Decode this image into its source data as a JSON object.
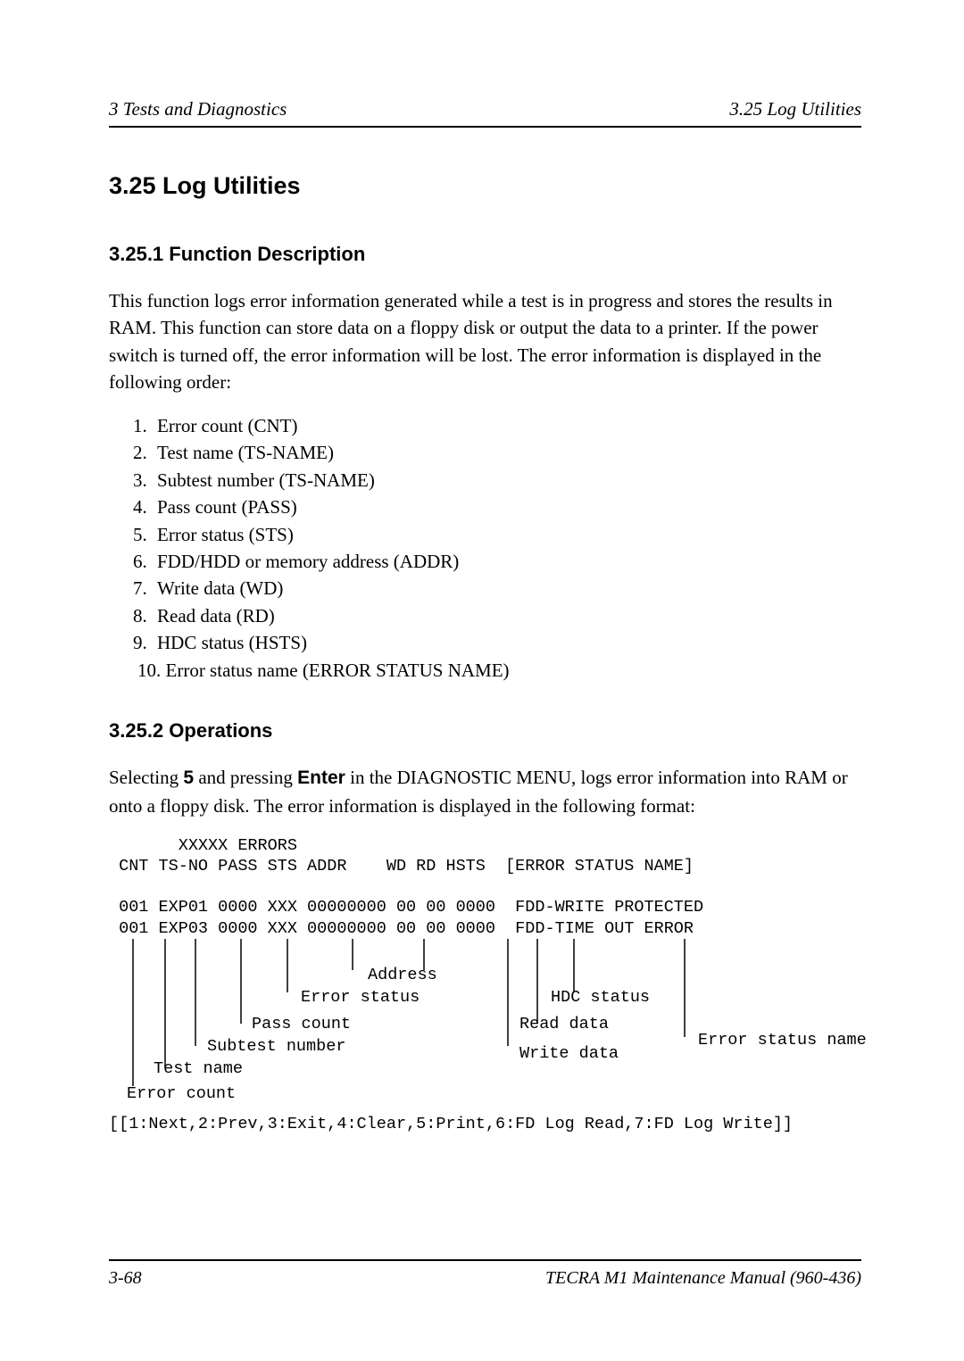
{
  "header": {
    "left": "3   Tests and Diagnostics",
    "right": "3.25  Log Utilities"
  },
  "section": {
    "title": "3.25  Log Utilities"
  },
  "sub1": {
    "title": "3.25.1   Function Description",
    "paragraph": "This function logs error information generated while a test is in progress and stores the results in RAM. This function can store data on a floppy disk or output the data to a printer. If the power switch is turned off, the error information will be lost. The error information is displayed in the following order:",
    "items": [
      "Error count (CNT)",
      "Test name (TS-NAME)",
      "Subtest number (TS-NAME)",
      "Pass count (PASS)",
      "Error status (STS)",
      "FDD/HDD or memory address (ADDR)",
      "Write data (WD)",
      "Read data (RD)",
      "HDC status (HSTS)",
      "Error status name (ERROR STATUS NAME)"
    ]
  },
  "sub2": {
    "title": "3.25.2   Operations",
    "p_prefix": "Selecting ",
    "p_key1": "5",
    "p_mid": " and pressing ",
    "p_key2": "Enter",
    "p_suffix": " in the DIAGNOSTIC MENU, logs error information into RAM or onto a floppy disk. The error information is displayed in the following format:",
    "mono_top": "       XXXXX ERRORS\n CNT TS-NO PASS STS ADDR    WD RD HSTS  [ERROR STATUS NAME]\n\n 001 EXP01 0000 XXX 00000000 00 00 0000  FDD-WRITE PROTECTED\n 001 EXP03 0000 XXX 00000000 00 00 0000  FDD-TIME OUT ERROR",
    "labels": {
      "address": "Address",
      "error_status": "Error status",
      "hdc_status": "HDC status",
      "pass_count": "Pass count",
      "read_data": "Read data",
      "subtest_number": "Subtest number",
      "error_status_name": "Error status name",
      "write_data": "Write data",
      "test_name": "Test name",
      "error_count": "Error count"
    },
    "mono_bottom": "[[1:Next,2:Prev,3:Exit,4:Clear,5:Print,6:FD Log Read,7:FD Log Write]]"
  },
  "footer": {
    "left": "3-68",
    "right": "TECRA M1 Maintenance Manual (960-436)"
  }
}
